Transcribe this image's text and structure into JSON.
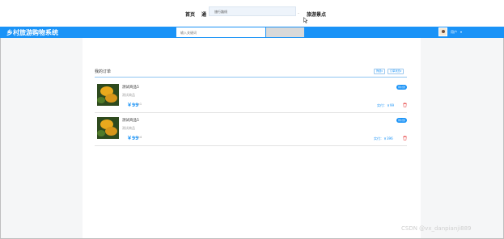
{
  "topnav": {
    "items": [
      "首页",
      "通",
      "旅游景点"
    ],
    "dropdown_item": "旅行路线",
    "dropdown_dash": "-"
  },
  "header": {
    "brand": "乡村旅游购物系统",
    "search_placeholder": "输入关键词",
    "search_button": "",
    "user_name": "用户",
    "user_caret": "▾"
  },
  "orders_section": {
    "title": "我的订单",
    "filters": [
      "筛选▾",
      "订单状态▾"
    ]
  },
  "orders": [
    {
      "name": "测试商品5",
      "category": "测试商品",
      "price": "￥99",
      "qty": "×1",
      "status": "待付款",
      "paid": "实付：￥99"
    },
    {
      "name": "测试商品5",
      "category": "测试商品",
      "price": "￥99",
      "qty": "×4",
      "status": "待付款",
      "paid": "实付：￥396"
    }
  ],
  "watermark": "CSDN @vx_danpianji889",
  "colors": {
    "accent": "#1a93f7",
    "delete": "#e64040"
  },
  "icons": {
    "cursor": "cursor-icon",
    "delete": "trash-icon",
    "avatar": "avatar-image"
  }
}
